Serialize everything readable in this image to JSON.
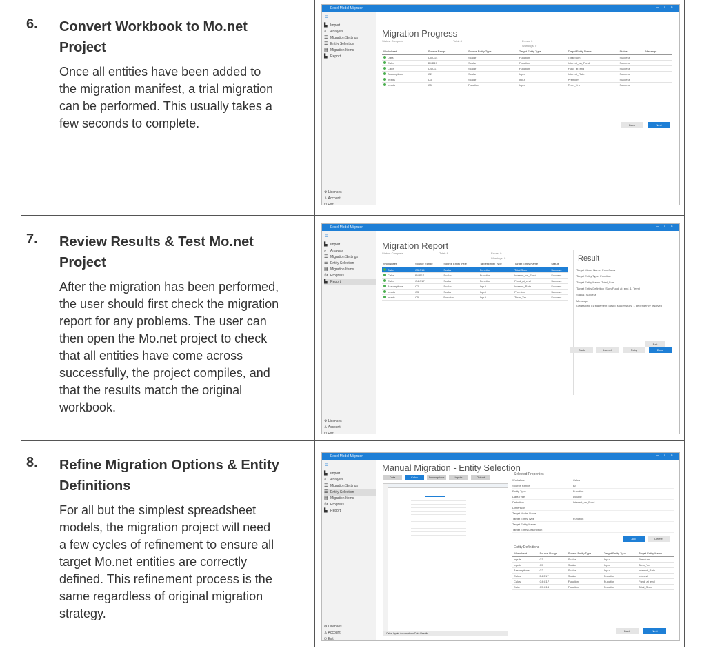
{
  "steps": [
    {
      "number": "6.",
      "title": "Convert Workbook to Mo.net Project",
      "body": "Once all entities have been added to the migration manifest, a trial migration can be performed.  This usually takes a few seconds to complete."
    },
    {
      "number": "7.",
      "title": "Review Results & Test Mo.net Project",
      "body": "After the migration has been performed, the user should first check the migration report for any problems.  The user can then open the Mo.net project to check that all entities have come across successfully, the project compiles, and that the results match the original workbook."
    },
    {
      "number": "8.",
      "title": "Refine Migration Options & Entity Definitions",
      "body": "For all but the simplest spreadsheet models, the migration project will need a few cycles of refinement to ensure all target Mo.net entities are correctly defined.  This refinement process is the same regardless of original migration strategy."
    }
  ],
  "app": {
    "window_title": "Excel Model Migrator",
    "window_controls": "– ▫ ×",
    "nav": [
      "Import",
      "Analysis",
      "Migration Settings",
      "Entity Selection",
      "Migration Items",
      "Progress",
      "Report"
    ],
    "nav_bottom": [
      "Licenses",
      "Account",
      "Exit"
    ],
    "progress": {
      "title": "Migration Progress",
      "meta": [
        "Status:  Complete",
        "Total:  8",
        "Errors:  0",
        "Warnings:  0"
      ],
      "headers": [
        "Worksheet",
        "Source Range",
        "Source Entity Type",
        "Target Entity Type",
        "Target Entity Name",
        "Status",
        "Message"
      ],
      "rows": [
        [
          "Data",
          "C5:C14",
          "Scalar",
          "Function",
          "Total Sum",
          "Success",
          ""
        ],
        [
          "Calcs",
          "B4:B17",
          "Scalar",
          "Function",
          "Interest_on_Fund",
          "Success",
          ""
        ],
        [
          "Calcs",
          "C4:C17",
          "Scalar",
          "Function",
          "Fund_at_end",
          "Success",
          ""
        ],
        [
          "Assumptions",
          "C2",
          "Scalar",
          "Input",
          "Interest_Rate",
          "Success",
          ""
        ],
        [
          "Inputs",
          "C3",
          "Scalar",
          "Input",
          "Premium",
          "Success",
          ""
        ],
        [
          "Inputs",
          "C5",
          "Function",
          "Input",
          "Term_Yrs",
          "Success",
          ""
        ]
      ],
      "back": "Back",
      "next": "Next"
    },
    "report": {
      "title": "Migration Report",
      "result_title": "Result",
      "headers": [
        "Worksheet",
        "Source Range",
        "Source Entity Type",
        "Target Entity Type",
        "Target Entity Name",
        "Status"
      ],
      "rows": [
        [
          "Data",
          "C5:C14",
          "Scalar",
          "Function",
          "Total Sum",
          "Success"
        ],
        [
          "Calcs",
          "B4:B17",
          "Scalar",
          "Function",
          "Interest_on_Fund",
          "Success"
        ],
        [
          "Calcs",
          "C4:C17",
          "Scalar",
          "Function",
          "Fund_at_end",
          "Success"
        ],
        [
          "Assumptions",
          "C2",
          "Scalar",
          "Input",
          "Interest_Rate",
          "Success"
        ],
        [
          "Inputs",
          "C3",
          "Scalar",
          "Input",
          "Premium",
          "Success"
        ],
        [
          "Inputs",
          "C5",
          "Function",
          "Input",
          "Term_Yrs",
          "Success"
        ]
      ],
      "result_rows": [
        [
          "Target Model Name",
          "FundCalcs"
        ],
        [
          "Target Entity Type",
          "Function"
        ],
        [
          "Target Entity Name",
          "Total_Sum"
        ],
        [
          "Target Entity Definition",
          "Sum(Fund_at_end, 1, Term)"
        ],
        [
          "Status",
          "Success"
        ]
      ],
      "message_label": "Message",
      "message": "Generated: #1 statement parsed successfully; 1 dependency resolved",
      "buttons": [
        "Back",
        "Launch",
        "Retry",
        "Done"
      ],
      "exit": "Exit"
    },
    "selection": {
      "title": "Manual Migration - Entity Selection",
      "tabs": [
        "Data",
        "Calcs",
        "Assumptions",
        "Inputs",
        "Output"
      ],
      "sheet_tabs": "Calcs  Inputs  Assumptions  Data  Results",
      "props_title": "Selected Properties",
      "props": [
        "Worksheet",
        "Source Range",
        "Entity Type",
        "Data Type",
        "Definition",
        "Dimension",
        "Target Model Name",
        "Target Entity Type",
        "Target Entity Name",
        "Target Entity Description"
      ],
      "prop_values": [
        "Calcs",
        "B4",
        "Function",
        "Double",
        "Interest_on_Fund",
        "",
        "",
        "Function",
        "",
        ""
      ],
      "add": "Add",
      "delete": "Delete",
      "defs_title": "Entity Definitions",
      "defs_headers": [
        "Worksheet",
        "Source Range",
        "Source Entity Type",
        "Target Entity Type",
        "Target Entity Name"
      ],
      "defs_rows": [
        [
          "Inputs",
          "C3",
          "Scalar",
          "Input",
          "Premium"
        ],
        [
          "Inputs",
          "C5",
          "Scalar",
          "Input",
          "Term_Yrs"
        ],
        [
          "Assumptions",
          "C2",
          "Scalar",
          "Input",
          "Interest_Rate"
        ],
        [
          "Calcs",
          "B4:B17",
          "Scalar",
          "Function",
          "Interest"
        ],
        [
          "Calcs",
          "C4:C17",
          "Function",
          "Function",
          "Fund_at_end"
        ],
        [
          "Data",
          "C5:C14",
          "Function",
          "Function",
          "Total_Sum"
        ]
      ],
      "back": "Back",
      "next": "Next"
    }
  }
}
